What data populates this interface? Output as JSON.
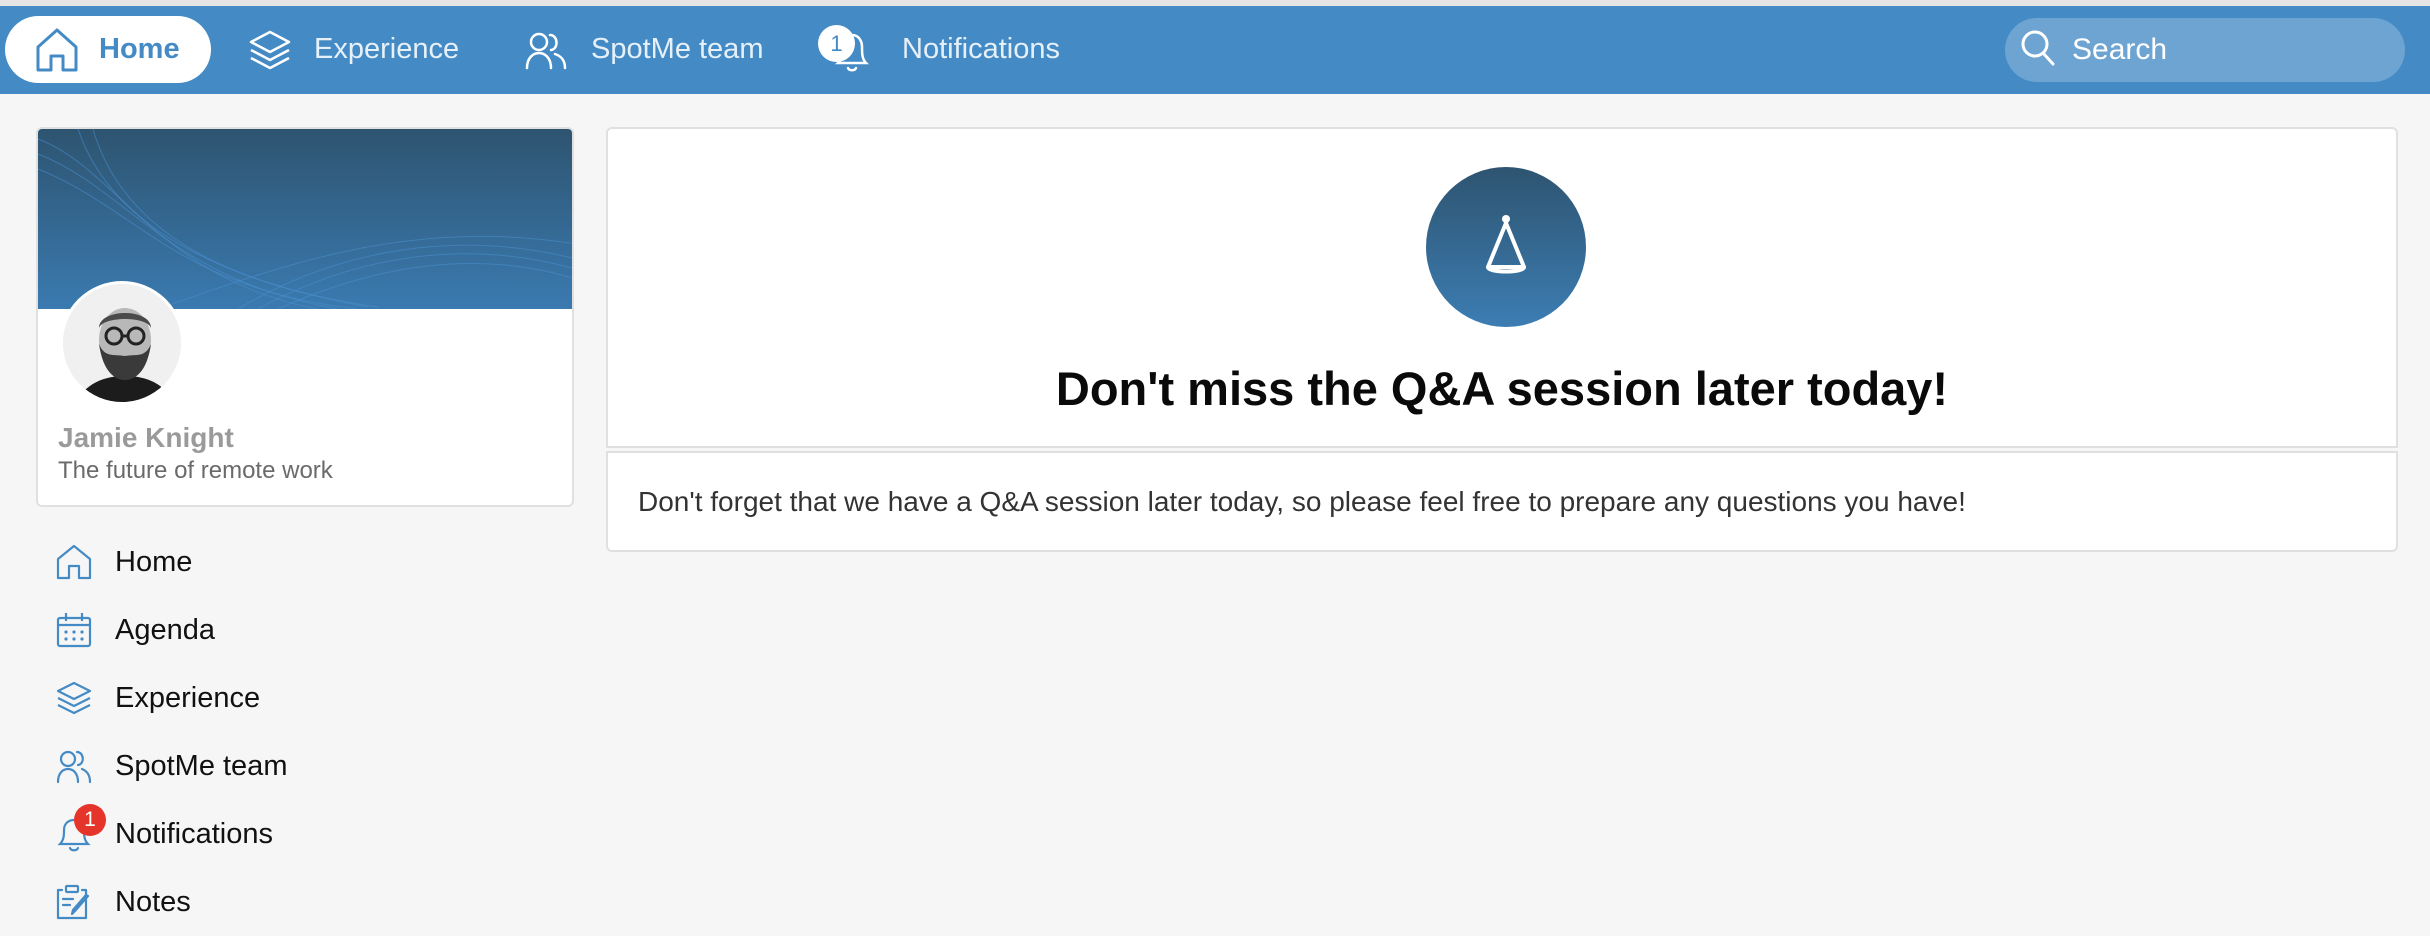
{
  "topbar": {
    "nav": [
      {
        "label": "Home",
        "icon": "home-icon",
        "active": true
      },
      {
        "label": "Experience",
        "icon": "layers-icon",
        "active": false
      },
      {
        "label": "SpotMe team",
        "icon": "users-icon",
        "active": false
      },
      {
        "label": "Notifications",
        "icon": "bell-icon",
        "active": false,
        "badge": "1"
      }
    ],
    "search": {
      "placeholder": "Search",
      "value": ""
    }
  },
  "profile": {
    "name": "Jamie Knight",
    "subtitle": "The future of remote work"
  },
  "sidebar": {
    "items": [
      {
        "label": "Home",
        "icon": "home-icon"
      },
      {
        "label": "Agenda",
        "icon": "calendar-icon"
      },
      {
        "label": "Experience",
        "icon": "layers-icon"
      },
      {
        "label": "SpotMe team",
        "icon": "users-icon"
      },
      {
        "label": "Notifications",
        "icon": "bell-icon",
        "badge": "1"
      },
      {
        "label": "Notes",
        "icon": "notes-icon"
      }
    ]
  },
  "main": {
    "hero_icon": "party-hat-icon",
    "title": "Don't miss the Q&A session later today!",
    "body": "Don't forget that we have a Q&A session later today, so please feel free to prepare any questions you have!"
  },
  "colors": {
    "brand_blue": "#448bc6",
    "badge_red": "#e5352b",
    "background": "#f6f6f6"
  }
}
